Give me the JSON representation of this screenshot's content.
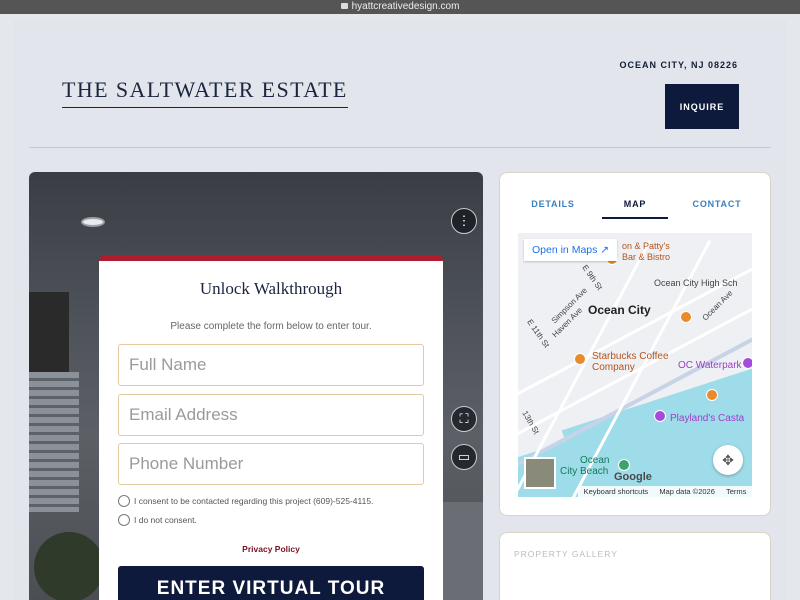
{
  "browser": {
    "url": "hyattcreativedesign.com"
  },
  "header": {
    "site_title": "THE SALTWATER ESTATE",
    "location": "OCEAN CITY, NJ 08226",
    "inquire_label": "INQUIRE"
  },
  "tour_gate": {
    "title": "Unlock Walkthrough",
    "subtitle": "Please complete the form below to enter tour.",
    "fields": {
      "full_name": "Full Name",
      "email": "Email Address",
      "phone": "Phone Number"
    },
    "consent_yes": "I consent to be contacted regarding this project (609)-525-4115.",
    "consent_no": "I do not consent.",
    "privacy_label": "Privacy Policy",
    "enter_label": "ENTER VIRTUAL TOUR"
  },
  "tour_controls": {
    "menu_icon": "⋮",
    "fullscreen_icon": "⛶",
    "vr_icon": "▭"
  },
  "side_panel": {
    "tabs": [
      "DETAILS",
      "MAP",
      "CONTACT"
    ],
    "active_tab": "MAP",
    "map": {
      "open_in_maps": "Open in Maps",
      "labels": {
        "bar": "on & Patty's",
        "bar2": "Bar & Bistro",
        "high_school": "Ocean City High Sch",
        "ocean_city": "Ocean City",
        "starbucks": "Starbucks Coffee",
        "starbucks2": "Company",
        "waterpark": "OC Waterpark",
        "playland": "Playland's Casta",
        "oc_beach": "Ocean",
        "oc_beach2": "City Beach",
        "simpson": "Simpson Ave",
        "e9th": "E 9th St",
        "haven": "Haven Ave",
        "e11th": "E 11th St",
        "ocean_ave": "Ocean Ave",
        "st13": "13th St"
      },
      "google": "Google",
      "keyboard": "Keyboard shortcuts",
      "mapdata": "Map data ©2026",
      "terms": "Terms"
    },
    "gallery_label": "PROPERTY GALLERY"
  },
  "colors": {
    "navy": "#0e1a3c",
    "accent_red": "#b01c2e",
    "tab_blue": "#3a7fc0"
  }
}
